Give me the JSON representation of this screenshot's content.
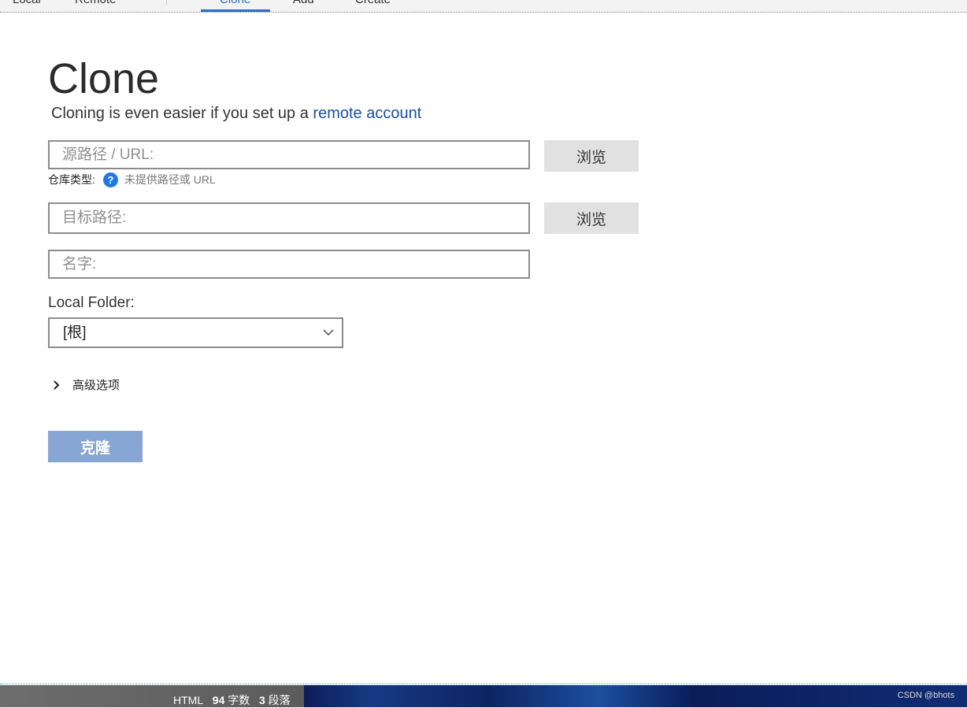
{
  "tabs": [
    {
      "label": "Local"
    },
    {
      "label": "Remote"
    },
    {
      "label": "Clone"
    },
    {
      "label": "Add"
    },
    {
      "label": "Create"
    }
  ],
  "page": {
    "title": "Clone",
    "subtitle_prefix": "Cloning is even easier if you set up a",
    "subtitle_link": "remote account"
  },
  "form": {
    "source_placeholder": "源路径 / URL:",
    "source_browse_label": "浏览",
    "repo_type_label": "仓库类型:",
    "repo_type_hint": "未提供路径或 URL",
    "target_placeholder": "目标路径:",
    "target_browse_label": "浏览",
    "name_placeholder": "名字:",
    "local_folder_label": "Local Folder:",
    "local_folder_value": "[根]",
    "advanced_label": "高级选项",
    "clone_button_label": "克隆"
  },
  "statusbar": {
    "mode": "HTML",
    "word_count": "94",
    "word_label": "字数",
    "paragraph_count": "3",
    "paragraph_label": "段落",
    "credit": "CSDN @bhots"
  },
  "colors": {
    "accent": "#2a6fc4",
    "link": "#1a4fa0",
    "clone_button": "#87a6d3",
    "help_icon": "#1f78e5"
  }
}
